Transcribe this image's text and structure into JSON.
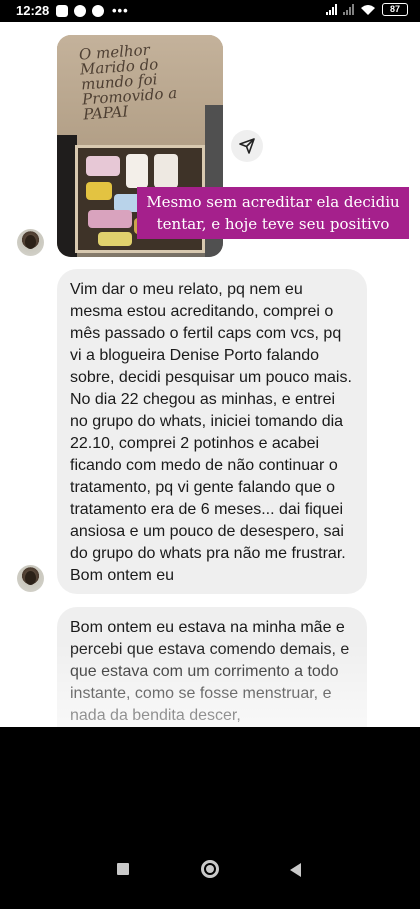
{
  "status_bar": {
    "time": "12:28",
    "battery": "87",
    "icons": [
      "instagram-icon",
      "facebook-icon",
      "facebook-icon",
      "more-dots-icon",
      "signal-icon",
      "signal-icon",
      "wifi-icon",
      "battery-icon"
    ],
    "more": "•••"
  },
  "post": {
    "photo_sign_text": "O melhor Marido do mundo foi Promovido a PAPAI",
    "caption": "Mesmo sem acreditar ela decidiu tentar, e hoje teve seu positivo"
  },
  "messages": [
    {
      "text": "Vim dar o meu relato, pq nem eu mesma estou acreditando, comprei o mês passado o fertil caps com vcs, pq vi a blogueira Denise Porto falando sobre, decidi pesquisar um pouco mais. No dia 22 chegou as minhas, e entrei no grupo do whats, iniciei tomando dia 22.10, comprei 2 potinhos e acabei ficando com medo de não continuar o tratamento, pq vi gente falando que o tratamento era de 6 meses... dai fiquei ansiosa e um pouco de desespero, sai do grupo do whats pra não me frustrar. Bom ontem eu"
    },
    {
      "text": "Bom ontem eu estava na minha mãe e percebi que estava comendo demais, e que estava com um corrimento a todo instante, como se fosse menstruar, e nada da bendita descer,"
    }
  ],
  "nav_bar": {
    "buttons": [
      "recents-square-icon",
      "home-circle-icon",
      "back-triangle-icon"
    ]
  },
  "colors": {
    "caption_bg": "#a5208c",
    "bubble_bg": "#efefef",
    "status_bg": "#000000"
  }
}
